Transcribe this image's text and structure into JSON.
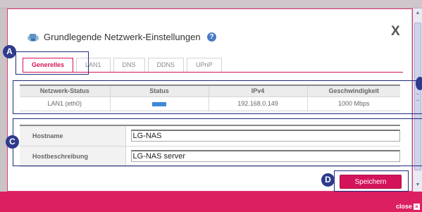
{
  "dialog": {
    "title": "Grundlegende Netzwerk-Einstellungen",
    "help_symbol": "?",
    "close_symbol": "X"
  },
  "tabs": [
    {
      "label": "Generelles",
      "active": true
    },
    {
      "label": "LAN1",
      "active": false
    },
    {
      "label": "DNS",
      "active": false
    },
    {
      "label": "DDNS",
      "active": false
    },
    {
      "label": "UPnP",
      "active": false
    }
  ],
  "status_table": {
    "headers": [
      "Netzwerk-Status",
      "Status",
      "IPv4",
      "Geschwindigkeit"
    ],
    "rows": [
      {
        "netzwerk": "LAN1 (eth0)",
        "status_color": "#3e8ad6",
        "ipv4": "192.168.0.149",
        "speed": "1000 Mbps"
      }
    ]
  },
  "form": {
    "hostname_label": "Hostname",
    "hostname_value": "LG-NAS",
    "description_label": "Hostbeschreibung",
    "description_value": "LG-NAS server"
  },
  "buttons": {
    "save_label": "Speichern"
  },
  "callouts": {
    "a": "A",
    "c": "C",
    "d": "D"
  },
  "footer": {
    "close_label": "close",
    "close_icon_symbol": "×"
  },
  "colors": {
    "accent": "#d4145a",
    "footer": "#dc1f61",
    "callout": "#2e3a8c"
  }
}
